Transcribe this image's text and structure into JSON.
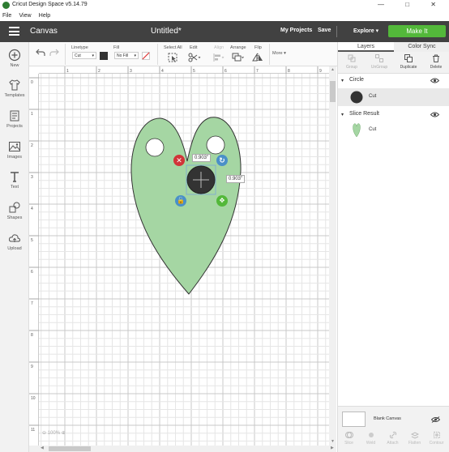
{
  "window": {
    "title": "Cricut Design Space  v5.14.79",
    "controls": [
      "—",
      "□",
      "✕"
    ]
  },
  "menu": [
    "File",
    "View",
    "Help"
  ],
  "header": {
    "section": "Canvas",
    "document_title": "Untitled*",
    "my_projects": "My Projects",
    "save": "Save",
    "machine": "Explore",
    "make_it": "Make It"
  },
  "sidebar": [
    {
      "label": "New",
      "icon": "plus-icon"
    },
    {
      "label": "Templates",
      "icon": "shirt-icon"
    },
    {
      "label": "Projects",
      "icon": "projects-icon"
    },
    {
      "label": "Images",
      "icon": "image-icon"
    },
    {
      "label": "Text",
      "icon": "text-icon"
    },
    {
      "label": "Shapes",
      "icon": "shapes-icon"
    },
    {
      "label": "Upload",
      "icon": "cloud-upload-icon"
    }
  ],
  "toolbar": {
    "linetype_label": "Linetype",
    "linetype_value": "Cut",
    "fill_label": "Fill",
    "fill_value": "No Fill",
    "select_all": "Select All",
    "edit": "Edit",
    "align": "Align",
    "arrange": "Arrange",
    "flip": "Flip",
    "more": "More"
  },
  "ruler": {
    "top": [
      "0",
      "1",
      "2",
      "3",
      "4",
      "5",
      "6",
      "7",
      "8",
      "9"
    ],
    "left": [
      "0",
      "1",
      "2",
      "3",
      "4",
      "5",
      "6",
      "7",
      "8",
      "9",
      "10",
      "11"
    ]
  },
  "canvas": {
    "width_dim": "0.903\"",
    "height_dim": "0.903\"",
    "zoom": "100%",
    "heart_color": "#a5d6a3",
    "circle_color": "#333333"
  },
  "panel": {
    "tabs": [
      "Layers",
      "Color Sync"
    ],
    "actions": [
      "Group",
      "UnGroup",
      "Duplicate",
      "Delete"
    ],
    "layers": [
      {
        "name": "Circle",
        "item": "Cut",
        "swatch": "#333333"
      },
      {
        "name": "Slice Result",
        "item": "Cut",
        "swatch": "#a5d6a3"
      }
    ],
    "blank_canvas": "Blank Canvas",
    "bottom_actions": [
      "Slice",
      "Weld",
      "Attach",
      "Flatten",
      "Contour"
    ]
  }
}
